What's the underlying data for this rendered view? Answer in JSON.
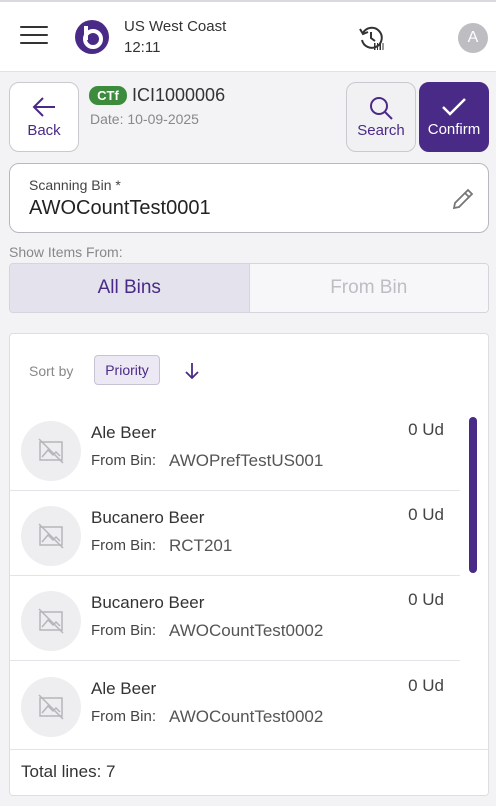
{
  "header": {
    "site": "US West Coast",
    "time": "12:11",
    "avatar_initial": "A"
  },
  "toolbar": {
    "back_label": "Back",
    "search_label": "Search",
    "confirm_label": "Confirm"
  },
  "document": {
    "type_badge": "CTf",
    "number": "ICI1000006",
    "date": "Date: 10-09-2025"
  },
  "scan": {
    "label": "Scanning Bin *",
    "value": "AWOCountTest0001"
  },
  "filter": {
    "caption": "Show Items From:",
    "options": [
      "All Bins",
      "From Bin"
    ],
    "selected": "All Bins"
  },
  "sort": {
    "label": "Sort by",
    "field": "Priority",
    "direction": "descending"
  },
  "items": [
    {
      "name": "Ale Beer",
      "bin_label": "From Bin:",
      "bin": "AWOPrefTestUS001",
      "qty": "0 Ud"
    },
    {
      "name": "Bucanero Beer",
      "bin_label": "From Bin:",
      "bin": "RCT201",
      "qty": "0 Ud"
    },
    {
      "name": "Bucanero Beer",
      "bin_label": "From Bin:",
      "bin": "AWOCountTest0002",
      "qty": "0 Ud"
    },
    {
      "name": "Ale Beer",
      "bin_label": "From Bin:",
      "bin": "AWOCountTest0002",
      "qty": "0 Ud"
    }
  ],
  "footer": {
    "total": "Total lines: 7"
  },
  "colors": {
    "primary": "#4a2a87",
    "badge_green": "#3d8b3d"
  }
}
